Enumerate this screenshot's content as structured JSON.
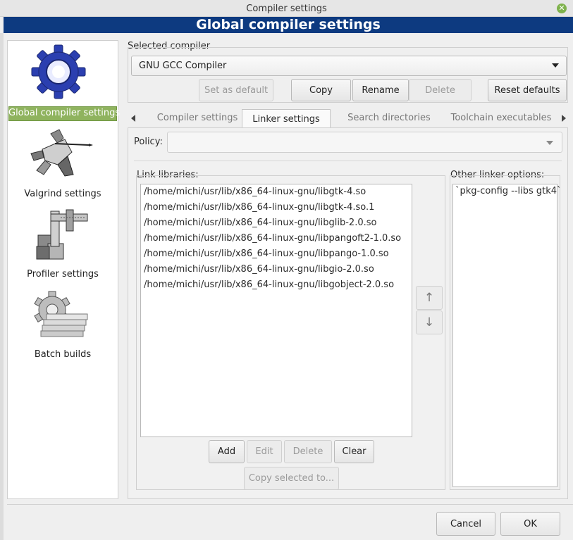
{
  "window": {
    "title": "Compiler settings"
  },
  "banner": {
    "title": "Global compiler settings"
  },
  "sidebar": {
    "items": [
      {
        "label": "Global compiler settings",
        "icon": "gear-icon",
        "selected": true
      },
      {
        "label": "Valgrind settings",
        "icon": "knight-icon"
      },
      {
        "label": "Profiler settings",
        "icon": "caliper-icon"
      },
      {
        "label": "Batch builds",
        "icon": "gear-stack-icon"
      }
    ]
  },
  "compiler": {
    "group_label": "Selected compiler",
    "selected": "GNU GCC Compiler",
    "buttons": {
      "set_default": "Set as default",
      "copy": "Copy",
      "rename": "Rename",
      "delete": "Delete",
      "reset": "Reset defaults"
    }
  },
  "tabs": [
    {
      "label": "Compiler settings",
      "active": false
    },
    {
      "label": "Linker settings",
      "active": true
    },
    {
      "label": "Search directories",
      "active": false
    },
    {
      "label": "Toolchain executables",
      "active": false
    }
  ],
  "policy": {
    "label": "Policy:",
    "value": ""
  },
  "link_libraries": {
    "label": "Link libraries:",
    "items": [
      "/home/michi/usr/lib/x86_64-linux-gnu/libgtk-4.so",
      "/home/michi/usr/lib/x86_64-linux-gnu/libgtk-4.so.1",
      "/home/michi/usr/lib/x86_64-linux-gnu/libglib-2.0.so",
      "/home/michi/usr/lib/x86_64-linux-gnu/libpangoft2-1.0.so",
      "/home/michi/usr/lib/x86_64-linux-gnu/libpango-1.0.so",
      "/home/michi/usr/lib/x86_64-linux-gnu/libgio-2.0.so",
      "/home/michi/usr/lib/x86_64-linux-gnu/libgobject-2.0.so"
    ],
    "buttons": {
      "add": "Add",
      "edit": "Edit",
      "delete": "Delete",
      "clear": "Clear",
      "copy_selected": "Copy selected to..."
    }
  },
  "other_linker": {
    "label": "Other linker options:",
    "value": "`pkg-config --libs gtk4`"
  },
  "dialog_buttons": {
    "cancel": "Cancel",
    "ok": "OK"
  },
  "colors": {
    "banner": "#0d3a80",
    "selection": "#8fb35e",
    "titlebar": "#e6e6e6",
    "close": "#7fb24c"
  }
}
